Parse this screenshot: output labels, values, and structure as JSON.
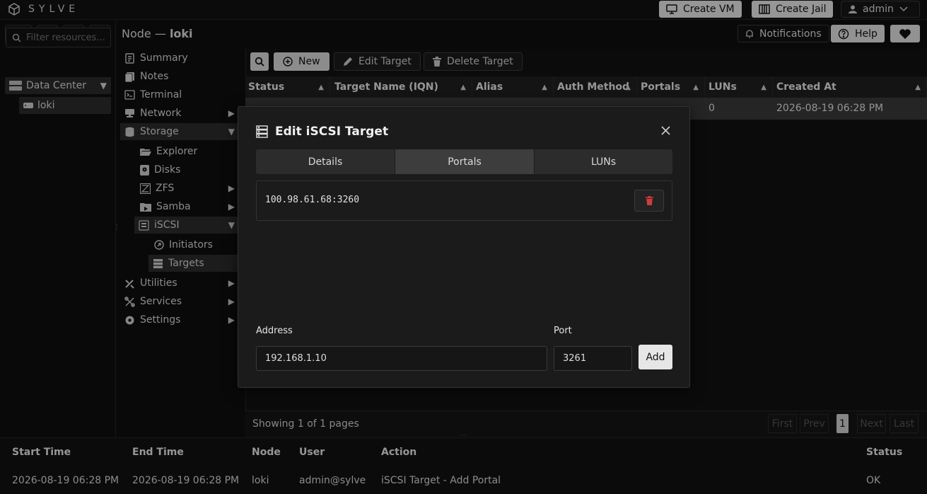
{
  "app": {
    "name": "SYLVE"
  },
  "topbar": {
    "create_vm": "Create VM",
    "create_jail": "Create Jail",
    "user": "admin"
  },
  "header": {
    "node_prefix": "Node —",
    "node_name": "loki",
    "notifications": "Notifications",
    "help": "Help"
  },
  "tree": {
    "filter_placeholder": "Filter resources...",
    "datacenter": "Data Center",
    "node": "loki"
  },
  "nav": {
    "summary": "Summary",
    "notes": "Notes",
    "terminal": "Terminal",
    "network": "Network",
    "storage": "Storage",
    "explorer": "Explorer",
    "disks": "Disks",
    "zfs": "ZFS",
    "samba": "Samba",
    "iscsi": "iSCSI",
    "initiators": "Initiators",
    "targets": "Targets",
    "utilities": "Utilities",
    "services": "Services",
    "settings": "Settings"
  },
  "toolbar": {
    "new": "New",
    "edit": "Edit Target",
    "delete": "Delete Target"
  },
  "table": {
    "columns": [
      "Status",
      "Target Name (IQN)",
      "Alias",
      "Auth Method",
      "Portals",
      "LUNs",
      "Created At"
    ],
    "row": {
      "luns": "0",
      "created_at": "2026-08-19 06:28 PM"
    },
    "footer": "Showing 1 of 1 pages",
    "pager": {
      "first": "First",
      "prev": "Prev",
      "page": "1",
      "next": "Next",
      "last": "Last"
    }
  },
  "modal": {
    "title": "Edit iSCSI Target",
    "tabs": [
      "Details",
      "Portals",
      "LUNs"
    ],
    "portal_entry": "100.98.61.68:3260",
    "address_label": "Address",
    "port_label": "Port",
    "address_value": "192.168.1.10",
    "port_value": "3261",
    "add": "Add"
  },
  "log": {
    "headers": {
      "start": "Start Time",
      "end": "End Time",
      "node": "Node",
      "user": "User",
      "action": "Action",
      "status": "Status"
    },
    "row": {
      "start": "2026-08-19 06:28 PM",
      "end": "2026-08-19 06:28 PM",
      "node": "loki",
      "user": "admin@sylve",
      "action": "iSCSI Target - Add Portal",
      "status": "OK"
    }
  },
  "colors": {
    "delete_red": "#d23b3b",
    "accent_light": "#e6e6e6"
  }
}
